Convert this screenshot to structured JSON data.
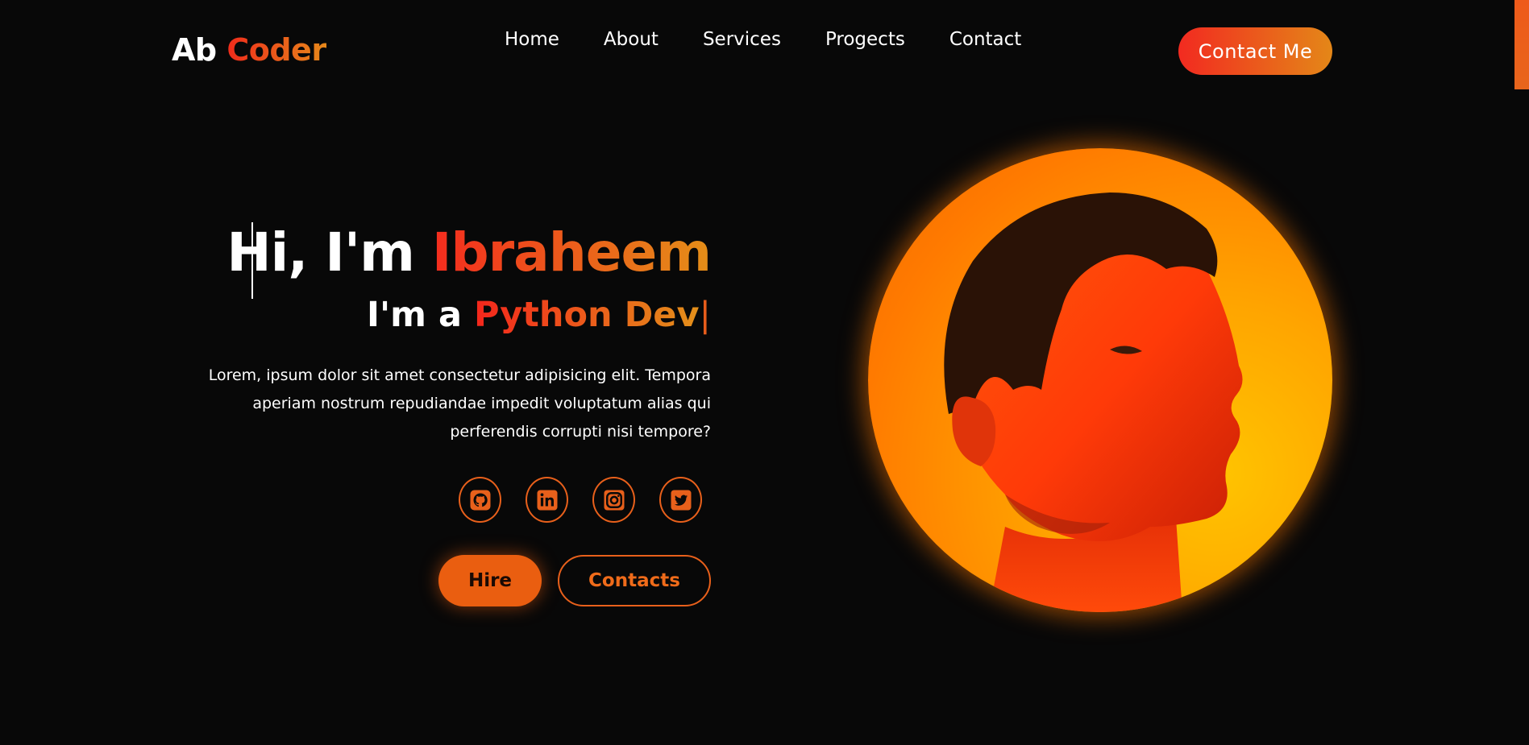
{
  "brand": {
    "first": "Ab",
    "second": "Coder"
  },
  "nav": [
    {
      "label": "Home"
    },
    {
      "label": "About"
    },
    {
      "label": "Services"
    },
    {
      "label": "Progects"
    },
    {
      "label": "Contact"
    }
  ],
  "header": {
    "cta_label": "Contact Me"
  },
  "hero": {
    "greeting": "Hi, I'm",
    "name": "Ibraheem",
    "role_prefix": "I'm a",
    "role": "Python Dev",
    "cursor": "|",
    "description": "Lorem, ipsum dolor sit amet consectetur adipisicing elit. Tempora aperiam nostrum repudiandae impedit voluptatum alias qui perferendis corrupti nisi tempore?"
  },
  "socials": [
    {
      "icon": "github-icon"
    },
    {
      "icon": "linkedin-icon"
    },
    {
      "icon": "instagram-icon"
    },
    {
      "icon": "twitter-icon"
    }
  ],
  "buttons": {
    "hire_label": "Hire",
    "contacts_label": "Contacts"
  },
  "colors": {
    "background": "#080808",
    "accent": "#e8601b",
    "gradient_start": "#f22a20",
    "gradient_end": "#e48718"
  }
}
